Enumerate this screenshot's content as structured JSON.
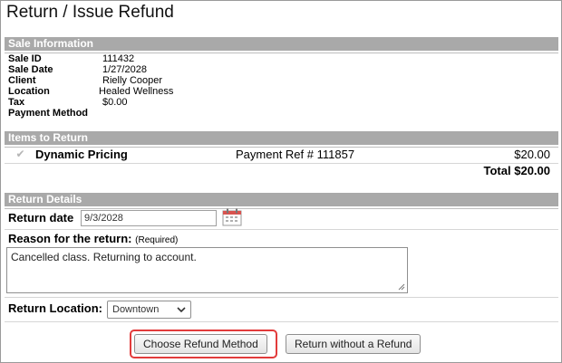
{
  "page": {
    "title": "Return / Issue Refund"
  },
  "sale_info": {
    "header": "Sale Information",
    "rows": [
      {
        "label": "Sale ID",
        "value": "111432"
      },
      {
        "label": "Sale Date",
        "value": "1/27/2028"
      },
      {
        "label": "Client",
        "value": "Rielly Cooper"
      },
      {
        "label": "Location",
        "value": "Healed Wellness"
      },
      {
        "label": "Tax",
        "value": "$0.00"
      },
      {
        "label": "Payment Method",
        "value": ""
      }
    ]
  },
  "items": {
    "header": "Items to Return",
    "rows": [
      {
        "name": "Dynamic Pricing",
        "ref": "Payment Ref # 111857",
        "amount": "$20.00",
        "checked": true
      }
    ],
    "total_label": "Total",
    "total_value": "$20.00"
  },
  "return_details": {
    "header": "Return Details",
    "date_label": "Return date",
    "date_value": "9/3/2028",
    "reason_label": "Reason for the return:",
    "reason_required": "(Required)",
    "reason_text": "Cancelled class. Returning to account.",
    "location_label": "Return Location:",
    "location_value": "Downtown"
  },
  "actions": {
    "choose_refund": "Choose Refund Method",
    "no_refund": "Return without a Refund"
  },
  "colors": {
    "section_bar": "#a9a9a9",
    "highlight": "#e23b3b",
    "calendar_accent": "#d9534f"
  }
}
